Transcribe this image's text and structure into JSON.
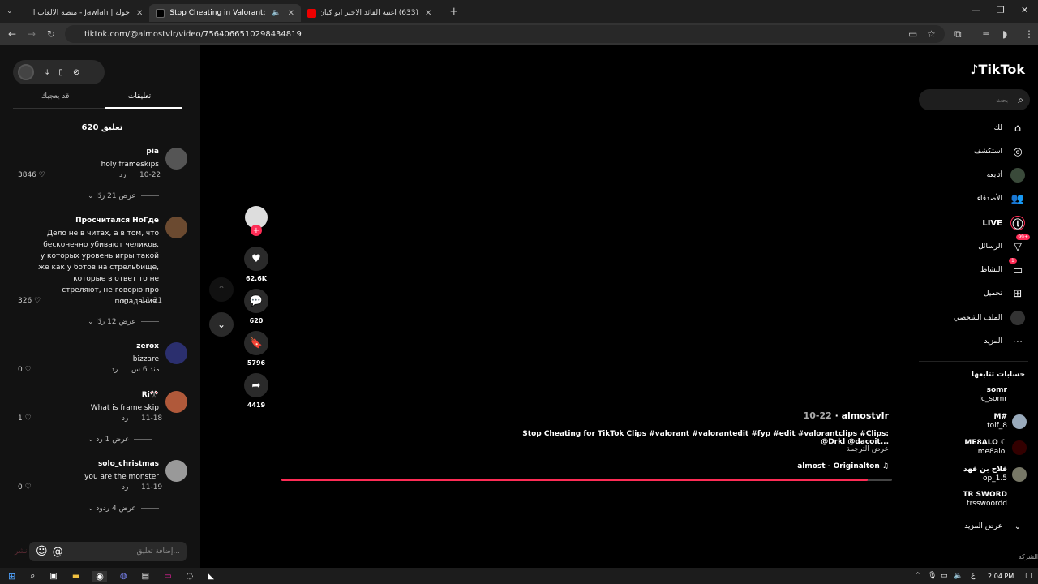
{
  "browser": {
    "tabs": [
      {
        "title": "جولة | Jawlah - منصة الألعاب الـ"
      },
      {
        "title": "Stop Cheating in Valorant: E"
      },
      {
        "title": "(633) اغنية القائد الاخير ابو كيان ر"
      }
    ],
    "new_tab": "+",
    "url": "tiktok.com/@almostvlr/video/7564066510298434819"
  },
  "comments": {
    "tab_comments": "تعليقات",
    "tab_liked": "قد يعجبك",
    "count_label": "620 تعليق",
    "reply_label": "رد",
    "items": [
      {
        "name": "pia",
        "text": "holy frameskips",
        "date": "10-22",
        "likes": "3846",
        "more": "عرض 21 ردًا"
      },
      {
        "name": "Просчитался НоГде",
        "text": "Дело не в читах, а в том, что бесконечно убивают челиков, у которых уровень игры такой же как у ботов на стрельбище, которые в ответ то не стреляют, не говорю про попадания.",
        "date": "11-21",
        "likes": "326",
        "more": "عرض 12 ردًا"
      },
      {
        "name": "zerox",
        "text": "bizzare",
        "date": "منذ 6 س",
        "likes": "0",
        "more": ""
      },
      {
        "name": "Ri🎌",
        "text": "What is frame skip",
        "date": "11-18",
        "likes": "1",
        "more": "عرض 1 رد"
      },
      {
        "name": "solo_christmas",
        "text": "you are the monster",
        "date": "11-19",
        "likes": "0",
        "more": "عرض 4 ردود"
      }
    ],
    "composer_placeholder": "إضافة تعليق...",
    "post_label": "نشر"
  },
  "video": {
    "likes": "62.6K",
    "comments": "620",
    "saves": "5796",
    "shares": "4419",
    "author": "almostvlr",
    "date": "10-22",
    "caption": "Stop Cheating for TikTok Clips #valorant #valorantedit #fyp #edit #valorantclips #Clips: @Drkl  @dacoit...",
    "translate": "عرض الترجمة",
    "sound": "almost - Originalton",
    "progress": 0.96
  },
  "sidebar": {
    "brand": "TikTok",
    "search_placeholder": "بحث",
    "nav": [
      {
        "label": "لك",
        "icon": "home-icon"
      },
      {
        "label": "استكشف",
        "icon": "compass-icon"
      },
      {
        "label": "أتابعه",
        "icon": "following-icon"
      },
      {
        "label": "الأصدقاء",
        "icon": "friends-icon"
      },
      {
        "label": "LIVE",
        "icon": "live-icon"
      },
      {
        "label": "الرسائل",
        "icon": "messages-icon",
        "badge": "99+"
      },
      {
        "label": "النشاط",
        "icon": "activity-icon",
        "badge": "1"
      },
      {
        "label": "تحميل",
        "icon": "upload-icon"
      },
      {
        "label": "الملف الشخصي",
        "icon": "profile-icon"
      },
      {
        "label": "المزيد",
        "icon": "more-icon"
      }
    ],
    "following_title": "حسابات تتابعها",
    "following": [
      {
        "name": "somr",
        "handle": "lc_somr"
      },
      {
        "name": "M#",
        "handle": "tolf_8"
      },
      {
        "name": "ME8ALO ☾",
        "handle": "me8alo."
      },
      {
        "name": "فلاح بن فهد",
        "handle": "op_1.5"
      },
      {
        "name": "TR SWORD",
        "handle": "trsswoordd"
      }
    ],
    "show_more": "عرض المزيد",
    "company": "الشركة"
  },
  "taskbar": {
    "time": "2:04 PM",
    "lang": "ع"
  }
}
